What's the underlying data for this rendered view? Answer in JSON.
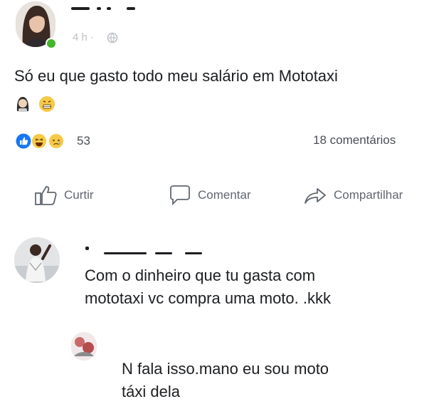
{
  "post": {
    "author_avatar": "woman-avatar",
    "online_color": "#42b72a",
    "time": "4 h",
    "separator": "·",
    "privacy_icon": "globe-icon",
    "text": "Só eu que gasto todo meu salário em Mototaxi",
    "emojis": [
      "woman-face-emoji",
      "grimacing-face-emoji"
    ]
  },
  "reactions": {
    "icons": [
      "like-icon",
      "haha-icon",
      "sad-icon"
    ],
    "count": "53",
    "comments": "18 comentários"
  },
  "actions": {
    "like": "Curtir",
    "comment": "Comentar",
    "share": "Compartilhar"
  },
  "comments": [
    {
      "avatar": "man-avatar",
      "line1": "Com o dinheiro que tu gasta com",
      "line2": "mototaxi  vc compra uma moto. .kkk"
    },
    {
      "avatar": "reply-avatar",
      "line1": "N fala isso.mano eu sou moto",
      "line2": "táxi dela"
    }
  ],
  "colors": {
    "like_blue": "#1877f2",
    "text": "#1c1e21",
    "muted": "#606770",
    "emoji_yellow": "#f7c948"
  }
}
